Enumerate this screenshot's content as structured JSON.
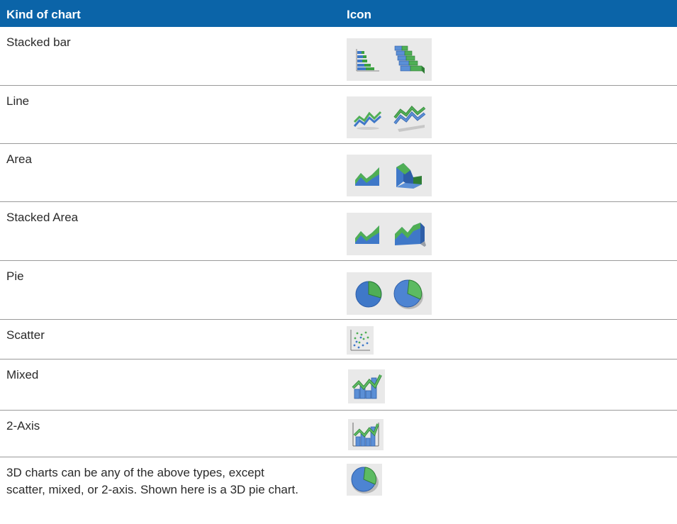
{
  "table": {
    "headers": {
      "kind": "Kind of chart",
      "icon": "Icon"
    },
    "rows": [
      {
        "label": "Stacked bar",
        "icons": [
          "stacked-bar-2d-icon",
          "stacked-bar-3d-icon"
        ]
      },
      {
        "label": "Line",
        "icons": [
          "line-2d-icon",
          "line-3d-icon"
        ]
      },
      {
        "label": "Area",
        "icons": [
          "area-2d-icon",
          "area-3d-icon"
        ]
      },
      {
        "label": "Stacked Area",
        "icons": [
          "stacked-area-2d-icon",
          "stacked-area-3d-icon"
        ]
      },
      {
        "label": "Pie",
        "icons": [
          "pie-2d-icon",
          "pie-3d-icon"
        ]
      },
      {
        "label": "Scatter",
        "icons": [
          "scatter-icon"
        ]
      },
      {
        "label": "Mixed",
        "icons": [
          "mixed-icon"
        ]
      },
      {
        "label": "2-Axis",
        "icons": [
          "two-axis-icon"
        ]
      },
      {
        "label": "3D charts can be any of the above types, except scatter, mixed, or 2-axis. Shown here is a 3D pie chart.",
        "icons": [
          "pie-3d-icon"
        ]
      }
    ]
  },
  "colors": {
    "header_bg": "#0b64a8",
    "icon_blue": "#3f78c8",
    "icon_green": "#3aa040",
    "icon_bg": "#e9e9e9"
  }
}
